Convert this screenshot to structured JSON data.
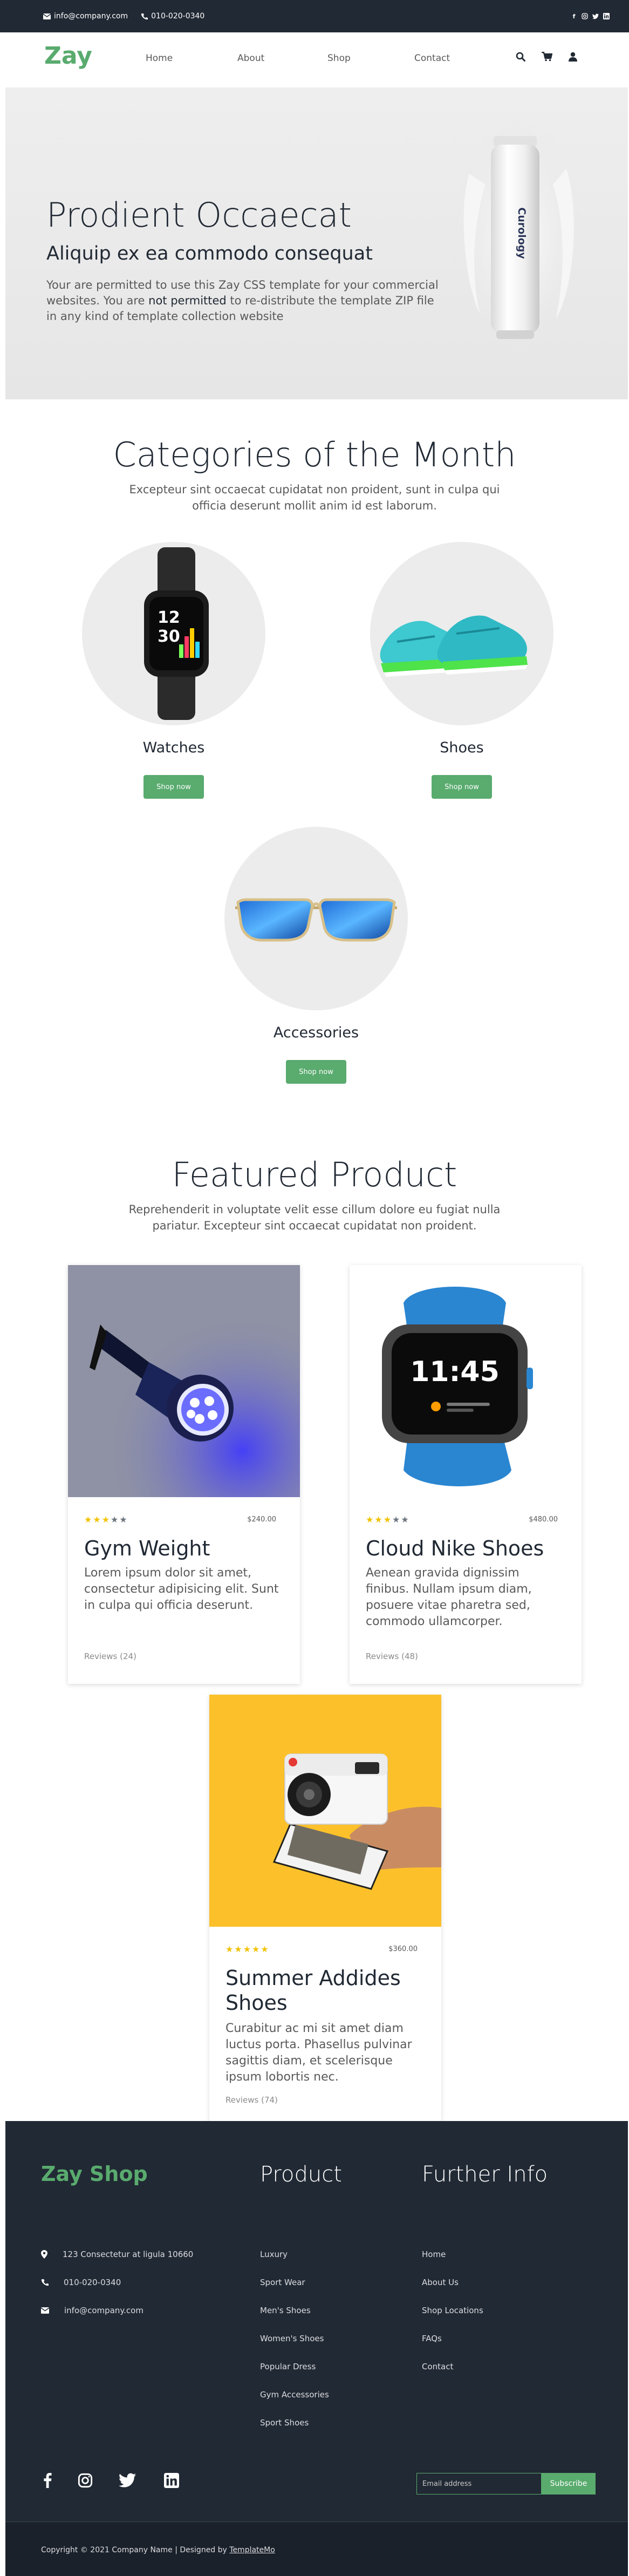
{
  "topbar": {
    "email": "info@company.com",
    "phone": "010-020-0340",
    "social_icons": [
      "facebook-icon",
      "instagram-icon",
      "twitter-icon",
      "linkedin-icon"
    ]
  },
  "header": {
    "logo": "Zay",
    "nav": [
      "Home",
      "About",
      "Shop",
      "Contact"
    ],
    "icons": [
      "search-icon",
      "cart-icon",
      "user-icon"
    ]
  },
  "hero": {
    "title": "Prodient Occaecat",
    "subtitle": "Aliquip ex ea commodo consequat",
    "text_before": "Your are permitted to use this Zay CSS template for your commercial websites. You are ",
    "text_bold": "not permitted",
    "text_after": " to re-distribute the template ZIP file in any kind of template collection website",
    "product_label": "Curology"
  },
  "categories": {
    "title": "Categories of the Month",
    "subtitle": "Excepteur sint occaecat cupidatat non proident, sunt in culpa qui officia deserunt mollit anim id est laborum.",
    "items": [
      {
        "name": "Watches",
        "button": "Shop now"
      },
      {
        "name": "Shoes",
        "button": "Shop now"
      },
      {
        "name": "Accessories",
        "button": "Shop now"
      }
    ]
  },
  "featured": {
    "title": "Featured Product",
    "subtitle": "Reprehenderit in voluptate velit esse cillum dolore eu fugiat nulla pariatur. Excepteur sint occaecat cupidatat non proident.",
    "products": [
      {
        "name": "Gym Weight",
        "price": "$240.00",
        "rating": 3,
        "desc": "Lorem ipsum dolor sit amet, consectetur adipisicing elit. Sunt in culpa qui officia deserunt.",
        "reviews": "Reviews (24)"
      },
      {
        "name": "Cloud Nike Shoes",
        "price": "$480.00",
        "rating": 3,
        "desc": "Aenean gravida dignissim finibus. Nullam ipsum diam, posuere vitae pharetra sed, commodo ullamcorper.",
        "reviews": "Reviews (48)"
      },
      {
        "name": "Summer Addides Shoes",
        "price": "$360.00",
        "rating": 5,
        "desc": "Curabitur ac mi sit amet diam luctus porta. Phasellus pulvinar sagittis diam, et scelerisque ipsum lobortis nec.",
        "reviews": "Reviews (74)"
      }
    ],
    "watch_time": "11:45"
  },
  "footer": {
    "brand": "Zay Shop",
    "col_product": "Product",
    "col_info": "Further Info",
    "contact": [
      {
        "icon": "location-icon",
        "text": "123 Consectetur at ligula 10660"
      },
      {
        "icon": "phone-icon",
        "text": "010-020-0340"
      },
      {
        "icon": "mail-icon",
        "text": "info@company.com"
      }
    ],
    "products": [
      "Luxury",
      "Sport Wear",
      "Men's Shoes",
      "Women's Shoes",
      "Popular Dress",
      "Gym Accessories",
      "Sport Shoes"
    ],
    "info": [
      "Home",
      "About Us",
      "Shop Locations",
      "FAQs",
      "Contact"
    ],
    "email_placeholder": "Email address",
    "subscribe": "Subscribe",
    "copyright": "Copyright © 2021 Company Name | Designed by ",
    "designer": "TemplateMo"
  }
}
